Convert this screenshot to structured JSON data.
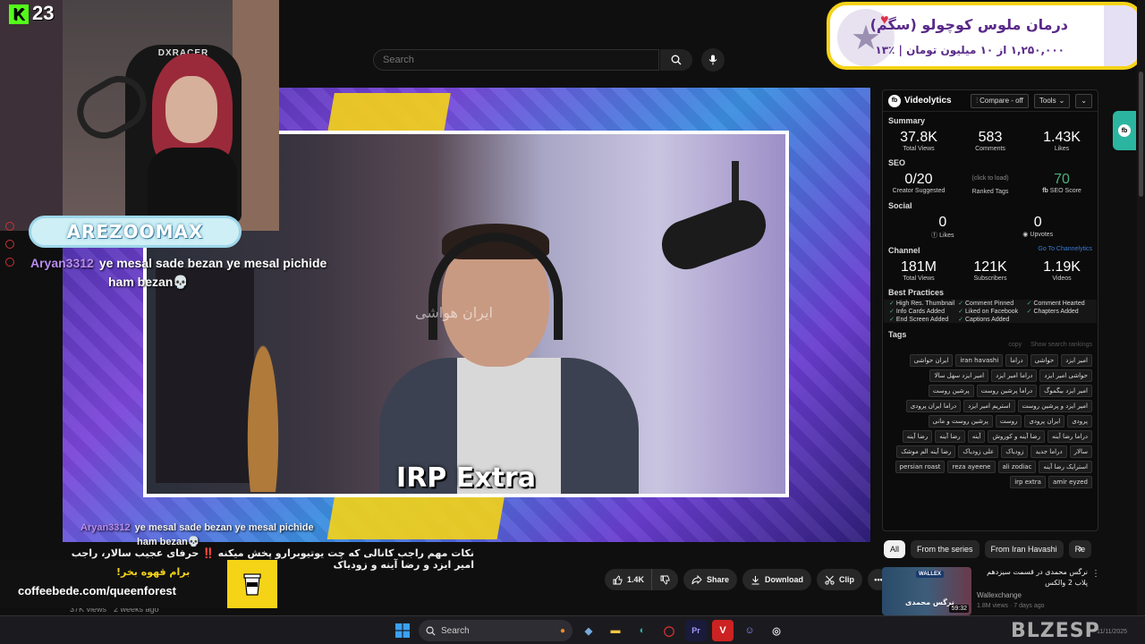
{
  "search": {
    "placeholder": "Search"
  },
  "stream": {
    "badge_count": "23",
    "chair_logo": "DXRACER",
    "streamer_name": "AREZOOMAX"
  },
  "chat": {
    "user": "Aryan3312",
    "line1": "ye mesal sade bezan ye mesal pichide",
    "line2": "ham bezan💀"
  },
  "video": {
    "overlay_watermark": "ایران هواشی",
    "caption": "IRP Extra",
    "title_alert": "‼️",
    "title": "نکات مهم راجب کانالی که چت یوتیوبرارو پخش میکنه",
    "title_tail": "حرفای عجیب سالار، راجب امیر ایزد و رضا آینه و زودیاک",
    "views": "37K views",
    "age": "2 weeks ago"
  },
  "actions": {
    "like_count": "1.4K",
    "share": "Share",
    "download": "Download",
    "clip": "Clip"
  },
  "coffee_ad": {
    "cta": "برام قهوه بخر!",
    "url": "coffeebede.com/queenforest"
  },
  "promo": {
    "line1": "درمان ملوس کوچولو (سگم)",
    "line2": "۱,۲۵۰,۰۰۰ از ۱۰ میلیون تومان | ٪۱۳"
  },
  "videolytics": {
    "brand": "Videolytics",
    "compare_btn": "Compare - off",
    "tools_btn": "Tools",
    "summary": {
      "heading": "Summary",
      "total_views": "37.8K",
      "total_views_label": "Total Views",
      "comments": "583",
      "comments_label": "Comments",
      "likes": "1.43K",
      "likes_label": "Likes"
    },
    "seo": {
      "heading": "SEO",
      "creator_suggested": "0/20",
      "creator_suggested_label": "Creator Suggested",
      "ranked_tags_hint": "(click to load)",
      "ranked_tags_label": "Ranked Tags",
      "seo_score": "70",
      "seo_score_label": "SEO Score"
    },
    "social": {
      "heading": "Social",
      "likes": "0",
      "likes_label": "Likes",
      "upvotes": "0",
      "upvotes_label": "Upvotes"
    },
    "channel": {
      "heading": "Channel",
      "link": "Go To Channelytics",
      "total_views": "181M",
      "total_views_label": "Total Views",
      "subscribers": "121K",
      "subscribers_label": "Subscribers",
      "videos": "1.19K",
      "videos_label": "Videos"
    },
    "best_practices": {
      "heading": "Best Practices",
      "items": [
        "High Res. Thumbnail",
        "Comment Pinned",
        "Comment Hearted",
        "Info Cards Added",
        "Liked on Facebook",
        "Chapters Added",
        "End Screen Added",
        "Captions Added",
        ""
      ]
    },
    "tags": {
      "heading": "Tags",
      "copy": "copy",
      "show_rankings": "Show search rankings",
      "items": [
        "امیر ایزد",
        "حواشی",
        "دراما",
        "iran havashi",
        "ایران حواشی",
        "حواشی امیر ایزد",
        "دراما امیر ایزد",
        "امیر ایزد سهل سالا",
        "امیر ایزد بیگموگ",
        "دراما پرشین روست",
        "پرشین روست",
        "امیر ایزد و پرشین روست",
        "استریم امیر ایزد",
        "دراما ایران پرودی",
        "پرودی",
        "ایران پرودی",
        "روست",
        "پرشین روست و مانی",
        "دراما رضا آینه",
        "رضا آینه و کوروش",
        "آینه",
        "رضا آینه",
        "رضا آینه",
        "سالار",
        "دراما جدید",
        "زودیاک",
        "علی زودیاک",
        "رضا آینه الم موشک",
        "استرایک رضا آینه",
        "ali zodiac",
        "reza ayeene",
        "persian roast",
        "amir eyzed",
        "irp extra"
      ]
    }
  },
  "chips": [
    "All",
    "From the series",
    "From Iran Havashi",
    "Re"
  ],
  "recommended": {
    "title": "نرگس محمدی در قسمت سیزدهم پلاب 2 والکس",
    "channel": "Wallexchange",
    "views": "1.8M views",
    "age": "7 days ago",
    "duration": "59:32",
    "thumb_name": "نرگس محمدی",
    "thumb_brand": "WALLEX"
  },
  "taskbar": {
    "search_label": "Search",
    "logo_text": "BLZESP",
    "date": "11/11/2025"
  },
  "colors": {
    "accent_yellow": "#f5d316",
    "kick_green": "#53fc18",
    "chat_user": "#b88cf0",
    "seo_green": "#4caf7d",
    "side_ext": "#2bb5a0"
  }
}
